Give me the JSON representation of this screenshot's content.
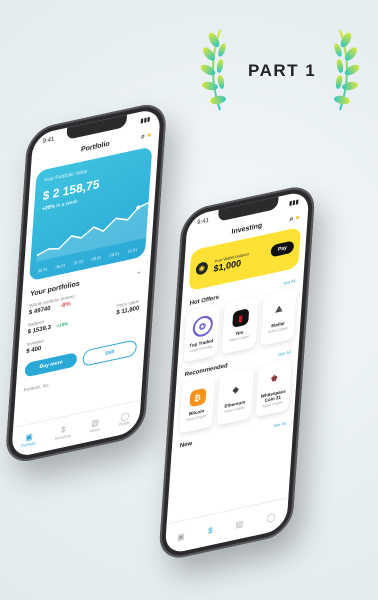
{
  "badge": {
    "text": "PART 1"
  },
  "portfolio": {
    "time": "9:41",
    "title": "Portfolio",
    "balance_label": "Your Portfolio Value",
    "balance": "$ 2 158,75",
    "change": "+20%",
    "change_period": "In a week",
    "axis": [
      "05.01",
      "06.01",
      "07.01",
      "08.01",
      "09.01",
      "10.01"
    ],
    "section_title": "Your portfolios",
    "fund1": {
      "label": "Whole portfolio (lorem)",
      "value": "$ 49740",
      "change": "-8%"
    },
    "grid": [
      {
        "label": "Balance",
        "value": "$ 1539,3",
        "change": "+10%"
      },
      {
        "label": "Price value",
        "value": "$ 11,800",
        "change": ""
      }
    ],
    "grid2": [
      {
        "label": "Invested",
        "value": "$ 400"
      }
    ],
    "buy_label": "Buy more",
    "sell_label": "Sell",
    "footer_label": "Portfolio, Inc.",
    "tabs": [
      {
        "label": "Portfolio",
        "icon": "portfolio-icon"
      },
      {
        "label": "Investing",
        "icon": "dollar-icon"
      },
      {
        "label": "News",
        "icon": "news-icon"
      },
      {
        "label": "Profile",
        "icon": "profile-icon"
      }
    ]
  },
  "investing": {
    "title": "Investing",
    "wallet_label": "Your Wallet balance",
    "wallet_amount": "$1,000",
    "pay_label": "Pay",
    "hot_offers_title": "Hot Offers",
    "see_all": "See All",
    "hot_offers": [
      {
        "name": "Top Traded",
        "sub": "Asset Growing",
        "color": "#6b5fd6"
      },
      {
        "name": "Nio",
        "sub": "Asset Crypto",
        "color": "#c41a2e"
      },
      {
        "name": "Stellar",
        "sub": "Asset Crypto",
        "color": "#222222"
      }
    ],
    "recommended_title": "Recommended",
    "recommended": [
      {
        "name": "Bitcoin",
        "sub": "Asset Crypto",
        "color": "#f7931a"
      },
      {
        "name": "Ethereum",
        "sub": "Asset Crypto",
        "color": "#3c3c3d"
      },
      {
        "name": "Whitespace Coin 21",
        "sub": "Asset Crypto",
        "color": "#8a3b3b"
      }
    ],
    "new_title": "New"
  },
  "colors": {
    "accent": "#2aa8d6",
    "wallet": "#fde235"
  }
}
